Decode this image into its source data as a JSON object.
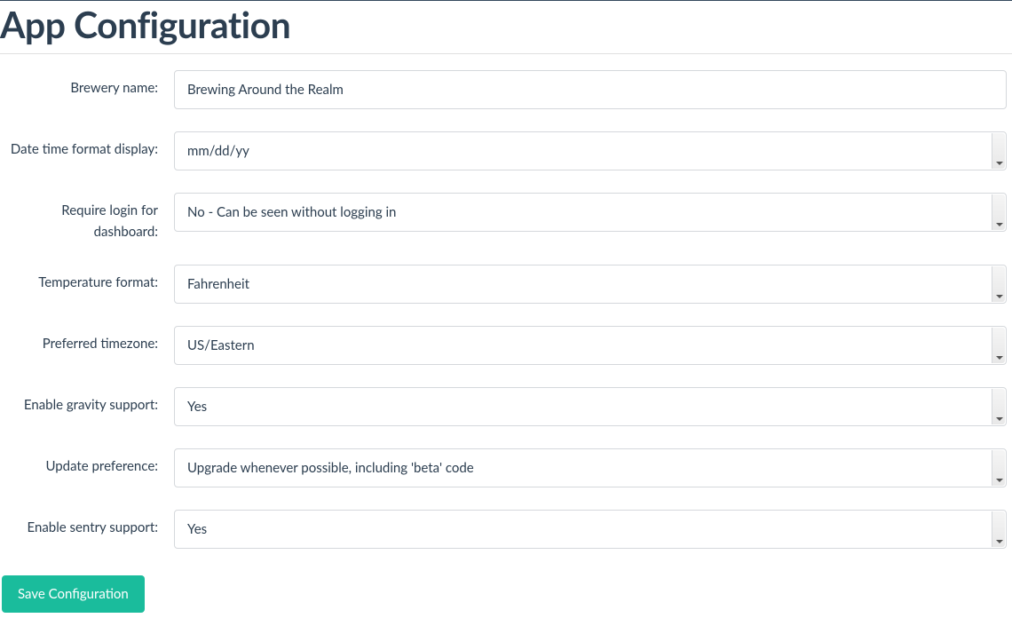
{
  "page": {
    "title": "App Configuration"
  },
  "form": {
    "brewery_name": {
      "label": "Brewery name:",
      "value": "Brewing Around the Realm"
    },
    "date_time_format": {
      "label": "Date time format display:",
      "value": "mm/dd/yy"
    },
    "require_login": {
      "label": "Require login for dashboard:",
      "value": "No - Can be seen without logging in"
    },
    "temperature_format": {
      "label": "Temperature format:",
      "value": "Fahrenheit"
    },
    "preferred_timezone": {
      "label": "Preferred timezone:",
      "value": "US/Eastern"
    },
    "enable_gravity": {
      "label": "Enable gravity support:",
      "value": "Yes"
    },
    "update_preference": {
      "label": "Update preference:",
      "value": "Upgrade whenever possible, including 'beta' code"
    },
    "enable_sentry": {
      "label": "Enable sentry support:",
      "value": "Yes"
    }
  },
  "actions": {
    "save_label": "Save Configuration"
  }
}
